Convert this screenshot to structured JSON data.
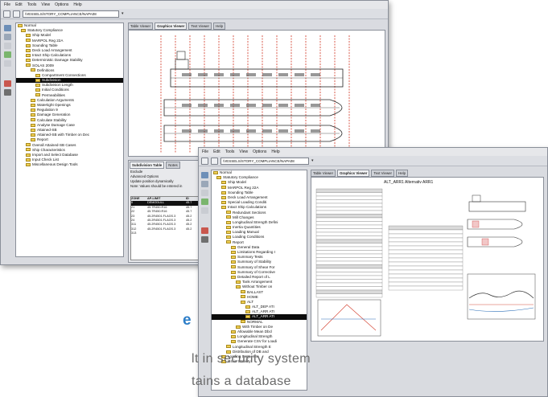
{
  "window1": {
    "menu": [
      "File",
      "Edit",
      "Tools",
      "View",
      "Options",
      "Help"
    ],
    "path": "/VESSELS/STORY_COMPLIANCE/NAPA08",
    "tree_root": "Normal",
    "tree": [
      {
        "label": "Statutory Compliance",
        "indent": 1
      },
      {
        "label": "Ship Model",
        "indent": 2
      },
      {
        "label": "MARPOL Reg 22A",
        "indent": 2
      },
      {
        "label": "Sounding Table",
        "indent": 2
      },
      {
        "label": "Deck Load Arrangement",
        "indent": 2
      },
      {
        "label": "Intact Ship Calculations",
        "indent": 2
      },
      {
        "label": "Deterministic Damage Stability",
        "indent": 2
      },
      {
        "label": "SOLAS 2009",
        "indent": 2
      },
      {
        "label": "Definitions",
        "indent": 3
      },
      {
        "label": "Compartment Connections",
        "indent": 4
      },
      {
        "label": "Subdivision",
        "indent": 4,
        "selected": true
      },
      {
        "label": "Subdivision Length",
        "indent": 4
      },
      {
        "label": "Initial Conditions",
        "indent": 4
      },
      {
        "label": "Permeabilities",
        "indent": 4
      },
      {
        "label": "Calculation Arguments",
        "indent": 3
      },
      {
        "label": "Watertight Openings",
        "indent": 3
      },
      {
        "label": "Regulation 9",
        "indent": 3
      },
      {
        "label": "Damage Generation",
        "indent": 3
      },
      {
        "label": "Calculate Stability",
        "indent": 3
      },
      {
        "label": "Analyse Damage Case",
        "indent": 3
      },
      {
        "label": "Attained-SB",
        "indent": 3
      },
      {
        "label": "Attained-SB with Timber on Dec",
        "indent": 3
      },
      {
        "label": "Report",
        "indent": 3
      },
      {
        "label": "Overall Attained-SB Cases",
        "indent": 2
      },
      {
        "label": "Ship Characteristics",
        "indent": 2
      },
      {
        "label": "Import and Select Database",
        "indent": 2
      },
      {
        "label": "Input Check List",
        "indent": 2
      },
      {
        "label": "Miscellaneous Design Tools",
        "indent": 2
      }
    ],
    "tabs": [
      "Table Viewer",
      "Graphics Viewer",
      "Text Viewer",
      "Help"
    ],
    "active_tab": "Graphics Viewer",
    "panel": {
      "tabs": [
        "Subdivision Table",
        "Notes"
      ],
      "rows": [
        "Exclude",
        "Advanced Options",
        "Update position dynamically",
        "Note: Values should be entered in"
      ],
      "header": [
        "ZONE",
        "AP-LIMIT",
        "ID"
      ],
      "data": [
        [
          "0",
          "DEMODULL",
          "45.7"
        ],
        [
          "21",
          "45.7R450.R16",
          "45.7"
        ],
        [
          "22",
          "45.7R450.R16",
          "45.7"
        ],
        [
          "23",
          "45.2R4501.FLAGS.3",
          "45.2"
        ],
        [
          "24",
          "45.2R4501.FLAGS.3",
          "45.2"
        ],
        [
          "311",
          "45.2R4501.FLAGS.3",
          "45.2"
        ],
        [
          "312",
          "45.2R4501.FLAGS.3",
          "45.2"
        ],
        [
          "313",
          "",
          ""
        ]
      ]
    }
  },
  "window2": {
    "menu": [
      "File",
      "Edit",
      "Tools",
      "View",
      "Options",
      "Help"
    ],
    "path": "/VESSELS/STORY_COMPLIANCE/NAPA08",
    "tree_root": "Normal",
    "tree": [
      {
        "label": "Statutory Compliance",
        "indent": 1
      },
      {
        "label": "Ship Model",
        "indent": 2
      },
      {
        "label": "MARPOL Reg 22A",
        "indent": 2
      },
      {
        "label": "Sounding Table",
        "indent": 2
      },
      {
        "label": "Deck Load Arrangement",
        "indent": 2
      },
      {
        "label": "Special Loading Conditi",
        "indent": 2
      },
      {
        "label": "Intact Ship Calculations",
        "indent": 2
      },
      {
        "label": "Redundant Sections",
        "indent": 3
      },
      {
        "label": "Mill Changes",
        "indent": 3
      },
      {
        "label": "Longitudinal Strength Defini",
        "indent": 3
      },
      {
        "label": "Inertia Quantities",
        "indent": 3
      },
      {
        "label": "Loading Manual",
        "indent": 3
      },
      {
        "label": "Loading Conditions",
        "indent": 3
      },
      {
        "label": "Report",
        "indent": 3
      },
      {
        "label": "General Data",
        "indent": 4
      },
      {
        "label": "Limitations Regarding I",
        "indent": 4
      },
      {
        "label": "Summary Tests",
        "indent": 4
      },
      {
        "label": "Summary of Stability",
        "indent": 4
      },
      {
        "label": "Summary of Shear For",
        "indent": 4
      },
      {
        "label": "Summary of Corrective",
        "indent": 4
      },
      {
        "label": "Detailed Report of L",
        "indent": 4
      },
      {
        "label": "Tank Arrangement",
        "indent": 5
      },
      {
        "label": "Without Timber on",
        "indent": 5
      },
      {
        "label": "BALLAST",
        "indent": 6
      },
      {
        "label": "HOME",
        "indent": 6
      },
      {
        "label": "ALT",
        "indent": 6
      },
      {
        "label": "ALT_DEP ATI",
        "indent": 7
      },
      {
        "label": "ALT_ARR ATI",
        "indent": 7
      },
      {
        "label": "ALT_ARR ATI",
        "indent": 7,
        "selected": true
      },
      {
        "label": "NORMAL",
        "indent": 6
      },
      {
        "label": "With Timber on De",
        "indent": 5
      },
      {
        "label": "Allowable Mean Dbcl",
        "indent": 4
      },
      {
        "label": "Longitudinal Strength",
        "indent": 4
      },
      {
        "label": "Generate CSV for Loadi",
        "indent": 4
      },
      {
        "label": "Longitudinal Strength E",
        "indent": 3
      },
      {
        "label": "Distribution of DB and",
        "indent": 3
      },
      {
        "label": "Loading Sequence",
        "indent": 2
      },
      {
        "label": "Grain Stability",
        "indent": 2
      }
    ],
    "tabs": [
      "Table Viewer",
      "Graphics Viewer",
      "Text Viewer",
      "Help"
    ],
    "active_tab": "Graphics Viewer",
    "doc_title": "ALT_ARR1 Alternativ ARR1"
  },
  "headline": "e",
  "body_lines": [
    "lt in security system",
    "tains a database"
  ],
  "colors": {
    "headline": "#2d7ec8",
    "body": "#6b6b6b",
    "folder": "#f0cf55",
    "selection": "#0b0b0b",
    "frame_line": "#d64a3a"
  }
}
